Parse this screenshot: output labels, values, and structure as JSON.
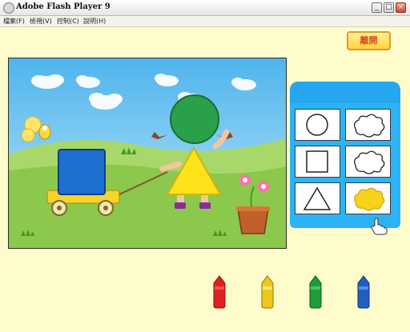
{
  "window": {
    "title": "Adobe Flash Player 9"
  },
  "title_buttons": [
    "minimize",
    "maximize",
    "close"
  ],
  "menu": [
    "檔案(F)",
    "檢視(V)",
    "控制(C)",
    "說明(H)"
  ],
  "leave_button": {
    "label": "離開"
  },
  "shape_panel": {
    "rows": [
      {
        "shape": "circle",
        "match_filled": false
      },
      {
        "shape": "square",
        "match_filled": false
      },
      {
        "shape": "triangle",
        "match_filled": true
      }
    ],
    "filled_color": "#f7d21b"
  },
  "crayons": [
    {
      "name": "red",
      "color": "#e02020"
    },
    {
      "name": "yellow",
      "color": "#f0c81c"
    },
    {
      "name": "green",
      "color": "#1f9b3a"
    },
    {
      "name": "blue",
      "color": "#1f5fbf"
    }
  ],
  "colors": {
    "page_bg": "#fffccc",
    "sky": "#6cc4ee",
    "grass": "#8bc34a",
    "panel": "#2cb3f5"
  }
}
